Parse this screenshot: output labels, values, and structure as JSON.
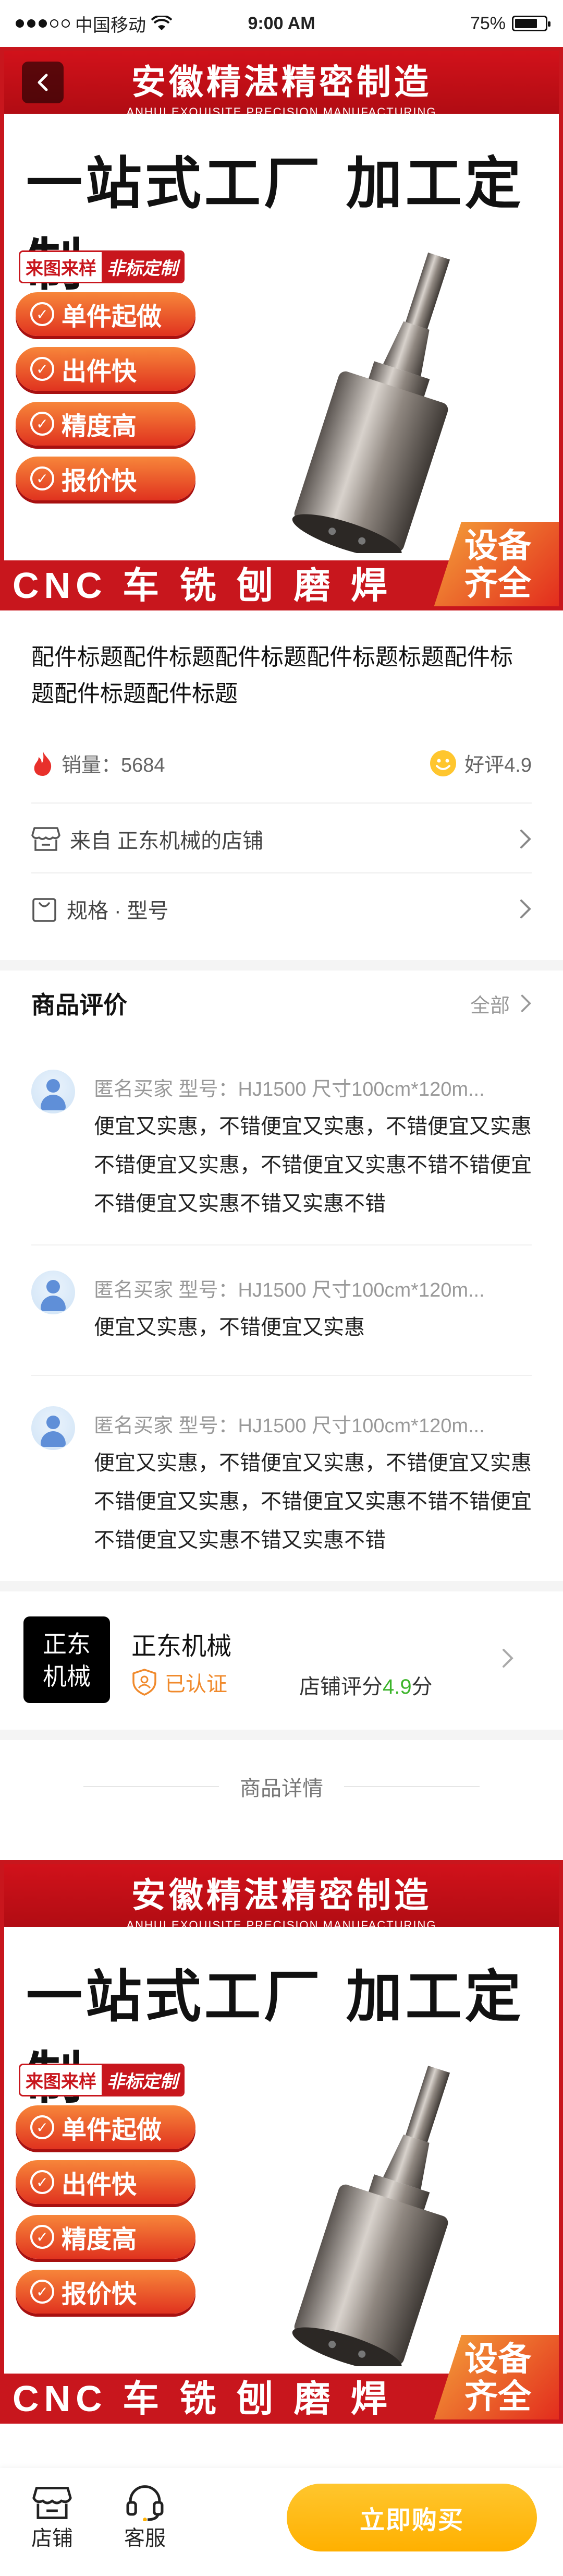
{
  "status_bar": {
    "carrier": "中国移动",
    "time": "9:00 AM",
    "battery": "75%",
    "battery_level": 0.75
  },
  "poster": {
    "brand_cn": "安徽精湛精密制造",
    "brand_en": "ANHUI EXQUISITE PRECISION MANUFACTURING",
    "slogan": "一站式工厂 加工定制",
    "tag_a": "来图来样",
    "tag_b": "非标定制",
    "features": [
      "单件起做",
      "出件快",
      "精度高",
      "报价快"
    ],
    "process": "CNC 车 铣 刨 磨 焊",
    "corner_line1": "设备",
    "corner_line2": "齐全"
  },
  "product": {
    "title": "配件标题配件标题配件标题配件标题标题配件标题配件标题配件标题",
    "sales_label": "销量：",
    "sales_value": "5684",
    "rating_label": "好评",
    "rating_value": "4.9",
    "store_link": "来自 正东机械的店铺",
    "spec_link": "规格 · 型号"
  },
  "reviews": {
    "heading": "商品评价",
    "all_label": "全部",
    "items": [
      {
        "meta": "匿名买家   型号：HJ1500 尺寸100cm*120m...",
        "text": "便宜又实惠，不错便宜又实惠，不错便宜又实惠不错便宜又实惠，不错便宜又实惠不错不错便宜不错便宜又实惠不错又实惠不错"
      },
      {
        "meta": "匿名买家   型号：HJ1500 尺寸100cm*120m...",
        "text": "便宜又实惠，不错便宜又实惠"
      },
      {
        "meta": "匿名买家   型号：HJ1500 尺寸100cm*120m...",
        "text": "便宜又实惠，不错便宜又实惠，不错便宜又实惠不错便宜又实惠，不错便宜又实惠不错不错便宜不错便宜又实惠不错又实惠不错"
      }
    ]
  },
  "store": {
    "logo_line1": "正东",
    "logo_line2": "机械",
    "name": "正东机械",
    "verified": "已认证",
    "score_label": "店铺评分",
    "score_value": "4.9",
    "score_unit": "分"
  },
  "details": {
    "heading": "商品详情"
  },
  "bottom_bar": {
    "store_tab": "店铺",
    "service_tab": "客服",
    "buy_button": "立即购买"
  },
  "colors": {
    "accent": "#ffb000",
    "brand_red": "#c8161d",
    "score_green": "#3cb42a",
    "verified_orange": "#f08a2c"
  }
}
